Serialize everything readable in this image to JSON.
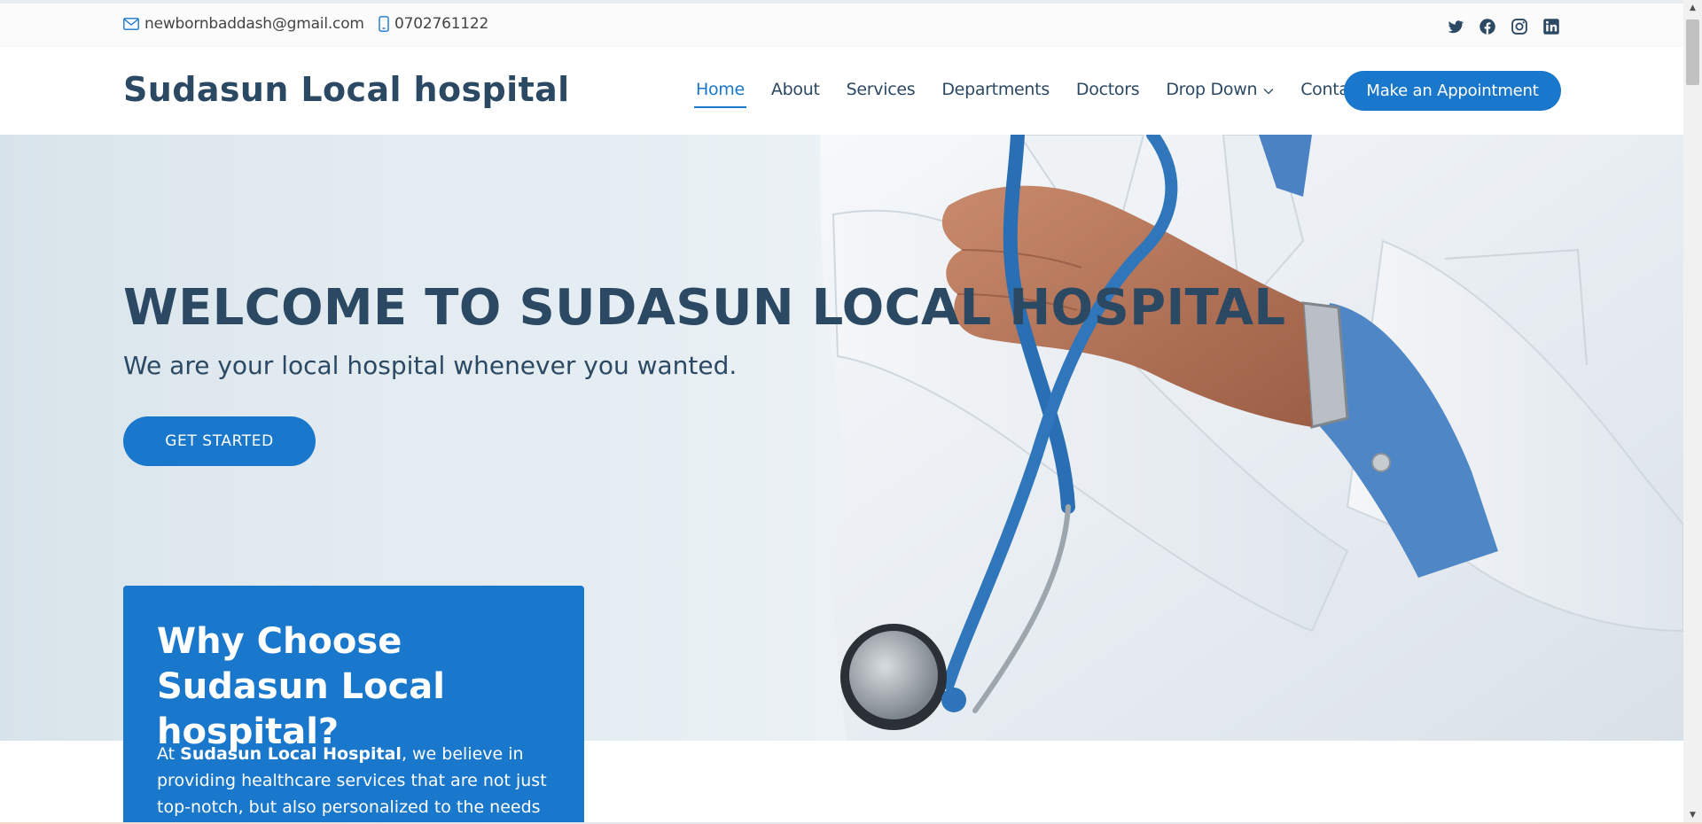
{
  "topbar": {
    "email": "newbornbaddash@gmail.com",
    "phone": "0702761122",
    "socials": [
      "twitter-icon",
      "facebook-icon",
      "instagram-icon",
      "linkedin-icon"
    ]
  },
  "header": {
    "logo": "Sudasun Local hospital",
    "nav": {
      "home": "Home",
      "about": "About",
      "services": "Services",
      "departments": "Departments",
      "doctors": "Doctors",
      "dropdown": "Drop Down",
      "contact": "Contact"
    },
    "active_item": "Home",
    "appointment_button": "Make an Appointment"
  },
  "hero": {
    "title": "WELCOME TO SUDASUN LOCAL HOSPITAL",
    "subtitle": "We are your local hospital whenever you wanted.",
    "cta": "GET STARTED"
  },
  "why": {
    "title": "Why Choose Sudasun Local hospital?",
    "text_prefix": "At ",
    "text_bold": "Sudasun Local Hospital",
    "text_suffix": ", we believe in providing healthcare services that are not just top-notch, but also personalized to the needs"
  },
  "colors": {
    "accent": "#1977cc",
    "heading": "#2c4964",
    "text": "#444444"
  }
}
